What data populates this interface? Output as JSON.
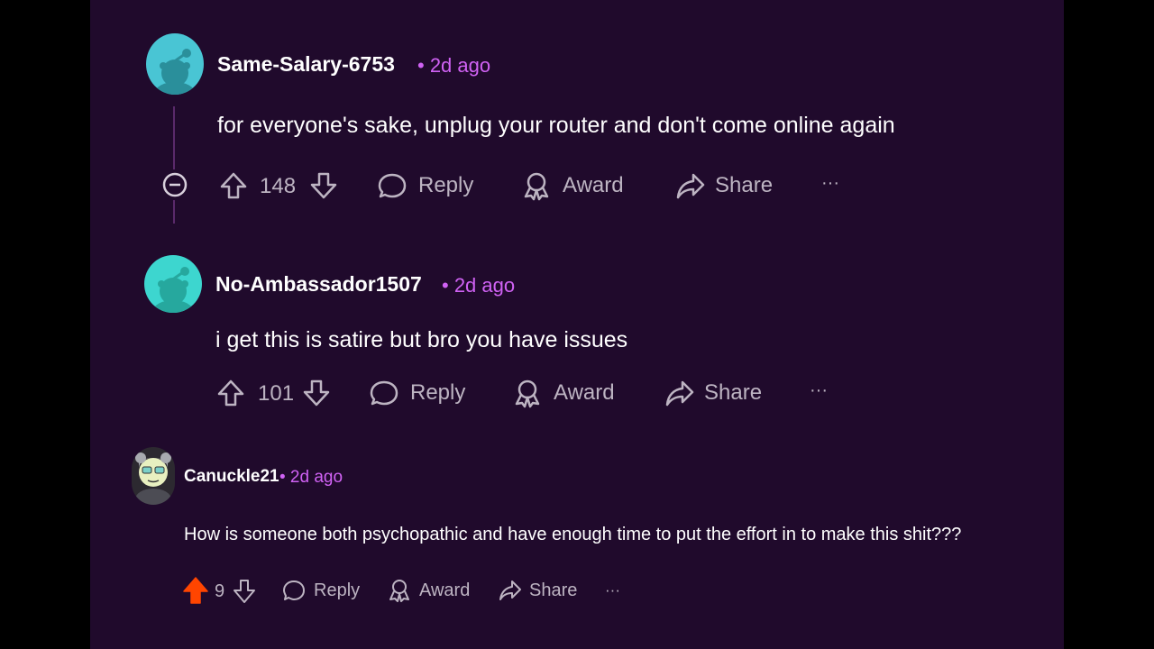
{
  "colors": {
    "background": "#200a2c",
    "time_accent": "#d062f4",
    "text": "#ffffff",
    "action": "#bdb4c2",
    "upvoted": "#ff4500",
    "avatar_cyan": "#3dd6cf"
  },
  "comments": [
    {
      "username": "Same-Salary-6753",
      "time": "• 2d ago",
      "text": "for everyone's sake, unplug your router and don't come online again",
      "score": "148",
      "reply_label": "Reply",
      "award_label": "Award",
      "share_label": "Share",
      "more_label": "···",
      "upvoted": false
    },
    {
      "username": "No-Ambassador1507",
      "time": "• 2d ago",
      "text": "i get this is satire but bro you have issues",
      "score": "101",
      "reply_label": "Reply",
      "award_label": "Award",
      "share_label": "Share",
      "more_label": "···",
      "upvoted": false
    },
    {
      "username": "Canuckle21",
      "time": "• 2d ago",
      "text": "How is someone both psychopathic and have enough time to put the effort in to make this shit???",
      "score": "9",
      "reply_label": "Reply",
      "award_label": "Award",
      "share_label": "Share",
      "more_label": "···",
      "upvoted": true
    }
  ]
}
